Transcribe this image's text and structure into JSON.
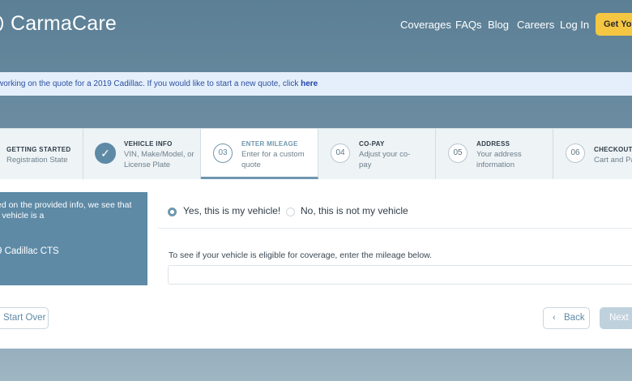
{
  "header": {
    "logo": "CarmaCare",
    "nav": [
      "Coverages",
      "FAQs",
      "Blog",
      "Careers",
      "Log In"
    ],
    "cta_label": "Get Your"
  },
  "banner": {
    "message": "working on the quote for a 2019 Cadillac. If you would like to start a new quote, click ",
    "link_label": "here"
  },
  "steps": [
    {
      "number": "",
      "title": "GETTING STARTED",
      "subtitle": "Registration State",
      "status": "done"
    },
    {
      "number": "✓",
      "title": "VEHICLE INFO",
      "subtitle": "VIN, Make/Model, or License Plate",
      "status": "done"
    },
    {
      "number": "03",
      "title": "ENTER MILEAGE",
      "subtitle": "Enter for a custom quote",
      "status": "current"
    },
    {
      "number": "04",
      "title": "CO-PAY",
      "subtitle": "Adjust your co-pay",
      "status": "upcoming"
    },
    {
      "number": "05",
      "title": "ADDRESS",
      "subtitle": "Your address information",
      "status": "upcoming"
    },
    {
      "number": "06",
      "title": "CHECKOUT",
      "subtitle": "Cart and Pa",
      "status": "upcoming"
    }
  ],
  "info_card": {
    "text": "ed on the provided info, we see that\nr vehicle is a",
    "vehicle": "9 Cadillac CTS"
  },
  "vehicle_confirm": {
    "yes_label": "Yes, this is my vehicle!",
    "no_label": "No, this is not my vehicle",
    "selected": "yes"
  },
  "mileage": {
    "prompt": "To see if your vehicle is eligible for coverage, enter the mileage below.",
    "value": "",
    "placeholder": ""
  },
  "buttons": {
    "start_over": "Start Over",
    "back": "Back",
    "next": "Next"
  },
  "colors": {
    "accent": "#5e8aa6",
    "cta": "#f5c642",
    "banner_bg": "#e4effb"
  }
}
